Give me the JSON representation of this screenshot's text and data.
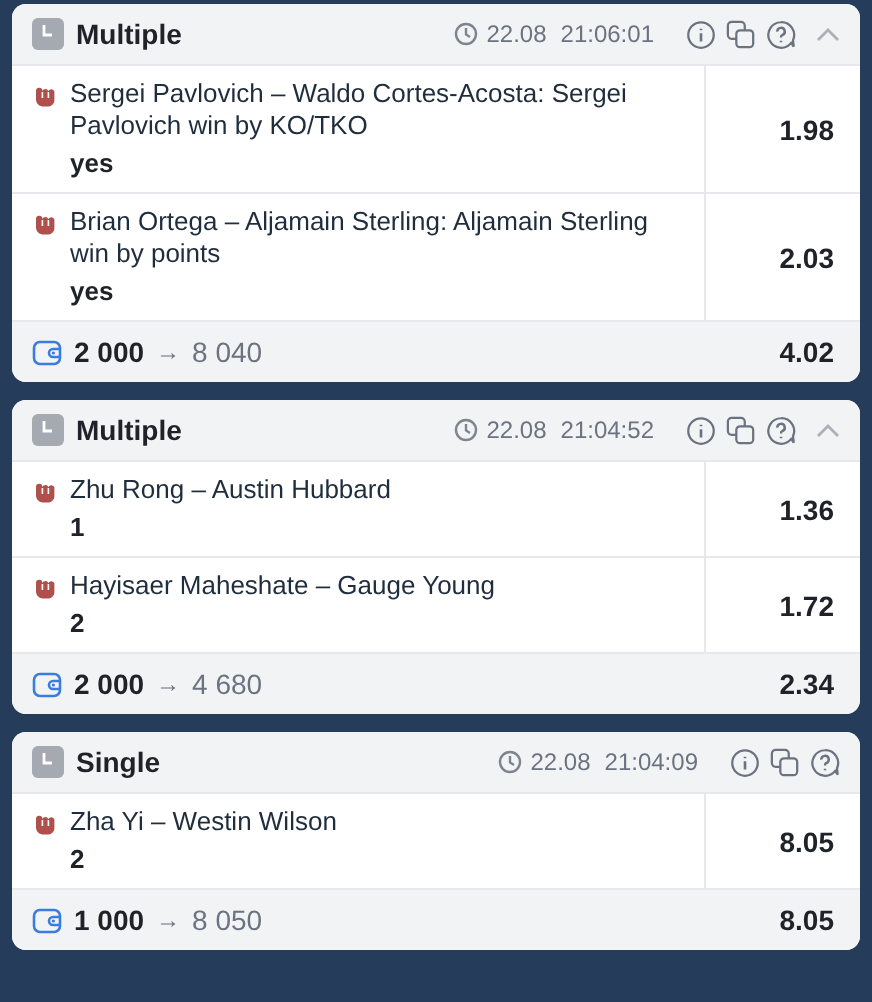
{
  "bets": [
    {
      "type": "Multiple",
      "date": "22.08",
      "time": "21:06:01",
      "collapsible": true,
      "selections": [
        {
          "event": "Sergei Pavlovich – Waldo Cortes-Acosta: Sergei Pavlovich win by KO/TKO",
          "pick": "yes",
          "odds": "1.98"
        },
        {
          "event": "Brian Ortega – Aljamain Sterling: Aljamain Sterling win by points",
          "pick": "yes",
          "odds": "2.03"
        }
      ],
      "stake": "2 000",
      "arrow": "→",
      "payout": "8 040",
      "total_odds": "4.02"
    },
    {
      "type": "Multiple",
      "date": "22.08",
      "time": "21:04:52",
      "collapsible": true,
      "selections": [
        {
          "event": "Zhu Rong – Austin Hubbard",
          "pick": "1",
          "odds": "1.36"
        },
        {
          "event": "Hayisaer Maheshate – Gauge Young",
          "pick": "2",
          "odds": "1.72"
        }
      ],
      "stake": "2 000",
      "arrow": "→",
      "payout": "4 680",
      "total_odds": "2.34"
    },
    {
      "type": "Single",
      "date": "22.08",
      "time": "21:04:09",
      "collapsible": false,
      "selections": [
        {
          "event": "Zha Yi – Westin Wilson",
          "pick": "2",
          "odds": "8.05"
        }
      ],
      "stake": "1 000",
      "arrow": "→",
      "payout": "8 050",
      "total_odds": "8.05"
    }
  ]
}
